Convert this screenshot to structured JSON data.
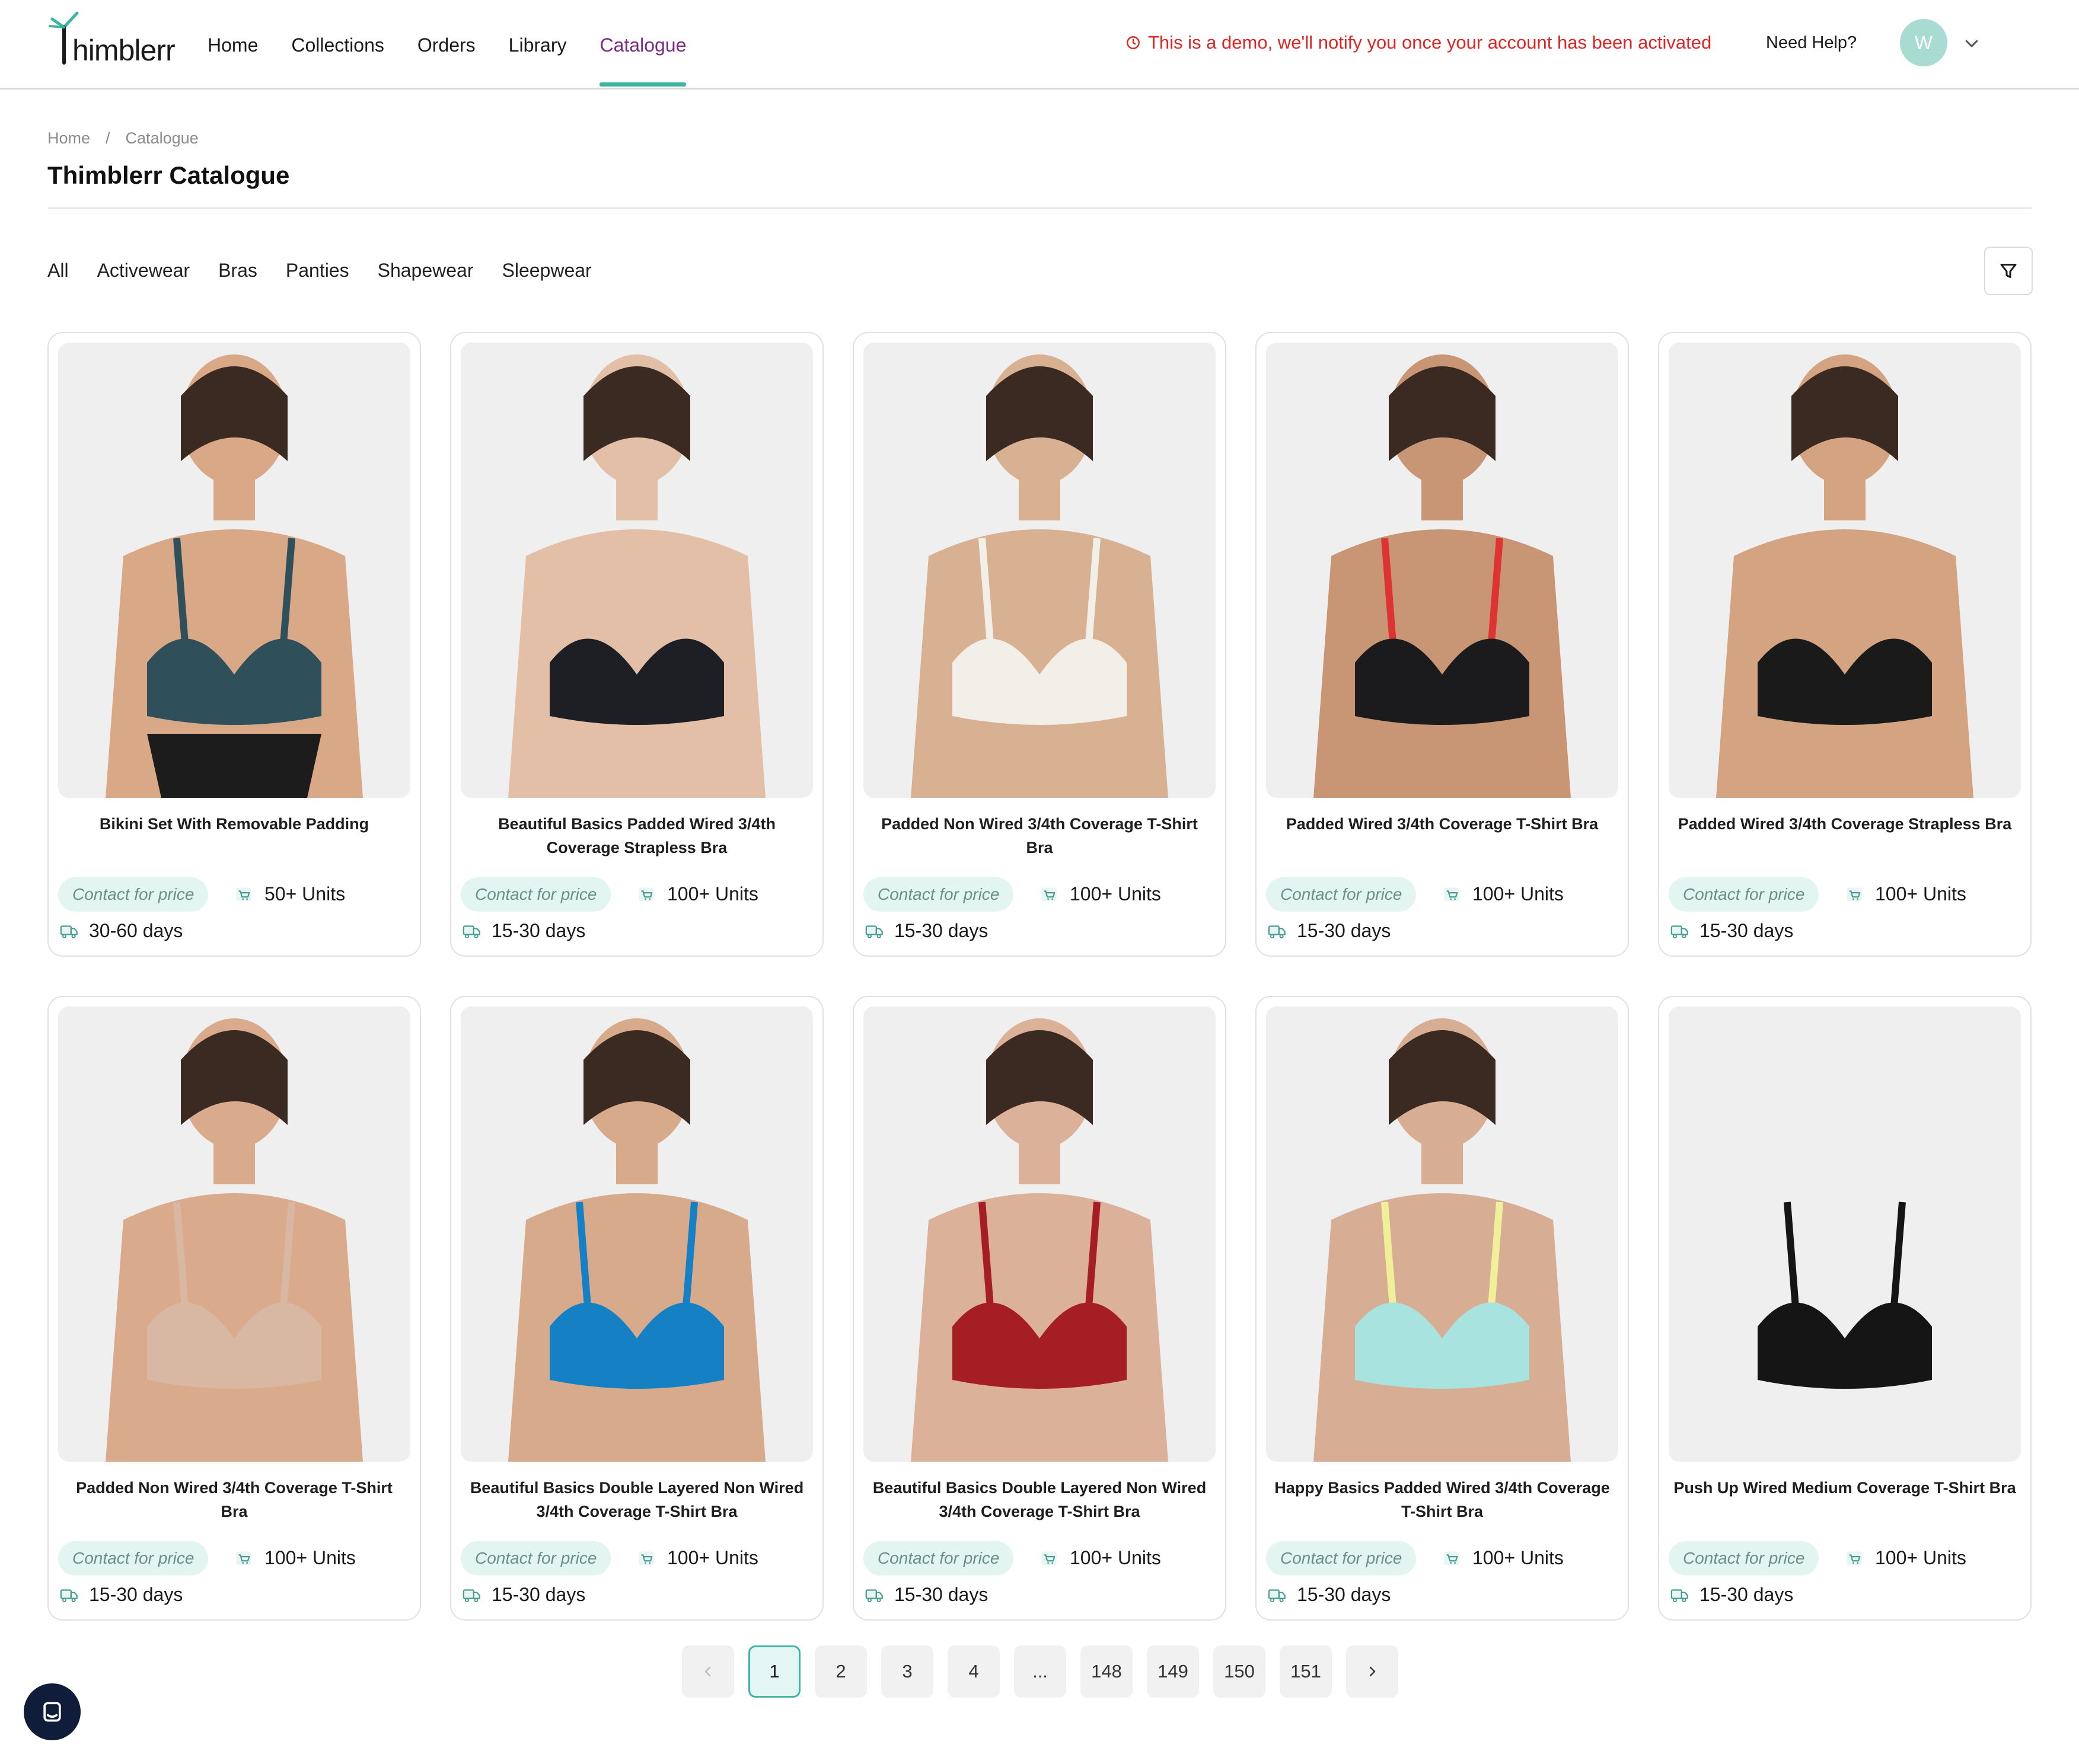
{
  "header": {
    "logo_text": "himblerr",
    "nav": [
      {
        "label": "Home"
      },
      {
        "label": "Collections"
      },
      {
        "label": "Orders"
      },
      {
        "label": "Library"
      },
      {
        "label": "Catalogue",
        "active": true
      }
    ],
    "demo_banner": "This is a demo, we'll notify you once your account has been activated",
    "need_help": "Need Help?",
    "avatar_initial": "W",
    "colors": {
      "active_nav": "#7b2a86",
      "accent": "#3fb4a3",
      "banner": "#e02424"
    }
  },
  "breadcrumb": [
    "Home",
    "/",
    "Catalogue"
  ],
  "page_title": "Thimblerr Catalogue",
  "filter_tabs": [
    "All",
    "Activewear",
    "Bras",
    "Panties",
    "Shapewear",
    "Sleepwear"
  ],
  "products": [
    {
      "title": "Bikini Set With Removable Padding",
      "price": "Contact for price",
      "units": "50+ Units",
      "lead_time": "30-60 days"
    },
    {
      "title": "Beautiful Basics Padded Wired 3/4th Coverage Strapless Bra",
      "price": "Contact for price",
      "units": "100+ Units",
      "lead_time": "15-30 days"
    },
    {
      "title": "Padded Non Wired 3/4th Coverage T-Shirt Bra",
      "price": "Contact for price",
      "units": "100+ Units",
      "lead_time": "15-30 days"
    },
    {
      "title": "Padded Wired 3/4th Coverage T-Shirt Bra",
      "price": "Contact for price",
      "units": "100+ Units",
      "lead_time": "15-30 days"
    },
    {
      "title": "Padded Wired 3/4th Coverage Strapless Bra",
      "price": "Contact for price",
      "units": "100+ Units",
      "lead_time": "15-30 days"
    },
    {
      "title": "Padded Non Wired 3/4th Coverage T-Shirt Bra",
      "price": "Contact for price",
      "units": "100+ Units",
      "lead_time": "15-30 days"
    },
    {
      "title": "Beautiful Basics Double Layered Non Wired 3/4th Coverage T-Shirt Bra",
      "price": "Contact for price",
      "units": "100+ Units",
      "lead_time": "15-30 days"
    },
    {
      "title": "Beautiful Basics Double Layered Non Wired 3/4th Coverage T-Shirt Bra",
      "price": "Contact for price",
      "units": "100+ Units",
      "lead_time": "15-30 days"
    },
    {
      "title": "Happy Basics Padded Wired 3/4th Coverage T-Shirt Bra",
      "price": "Contact for price",
      "units": "100+ Units",
      "lead_time": "15-30 days"
    },
    {
      "title": "Push Up Wired Medium Coverage T-Shirt Bra",
      "price": "Contact for price",
      "units": "100+ Units",
      "lead_time": "15-30 days"
    }
  ],
  "pagination": {
    "prev_icon": "chevron-left-icon",
    "next_icon": "chevron-right-icon",
    "pages": [
      "1",
      "2",
      "3",
      "4",
      "...",
      "148",
      "149",
      "150",
      "151"
    ],
    "current": "1"
  }
}
